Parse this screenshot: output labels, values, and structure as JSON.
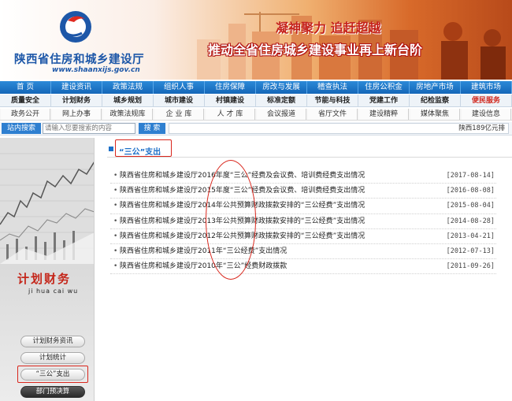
{
  "header": {
    "org_name": "陕西省住房和城乡建设厅",
    "url": "www.shaanxijs.gov.cn",
    "slogan1": "凝神聚力  追赶超越",
    "slogan2": "推动全省住房城乡建设事业再上新台阶"
  },
  "nav_primary": [
    "首    页",
    "建设资讯",
    "政策法规",
    "组织人事",
    "住房保障",
    "房改与发展",
    "稽查执法",
    "住房公积金",
    "房地产市场",
    "建筑市场"
  ],
  "nav_secondary": [
    "质量安全",
    "计划财务",
    "城乡规划",
    "城市建设",
    "村镇建设",
    "标准定额",
    "节能与科技",
    "党建工作",
    "纪检监察",
    "便民服务"
  ],
  "nav_tertiary": [
    "政务公开",
    "网上办事",
    "政策法规库",
    "企 业 库",
    "人 才 库",
    "会议报道",
    "省厅文件",
    "建设精粹",
    "媒体聚焦",
    "建设信息"
  ],
  "search": {
    "label": "站内搜索",
    "placeholder": "请输入您要搜索的内容",
    "button": "搜 索",
    "ticker": "陕西189亿元排"
  },
  "sidebar": {
    "title": "计划财务",
    "pinyin": "ji hua cai wu",
    "buttons": [
      "计划财务资讯",
      "计划统计",
      "“三公”支出",
      "部门预决算"
    ]
  },
  "section": {
    "title": "“三公”支出"
  },
  "articles": [
    {
      "title": "陕西省住房和城乡建设厅2016年度“三公”经费及会议费、培训费经费支出情况",
      "date": "[2017-08-14]"
    },
    {
      "title": "陕西省住房和城乡建设厅2015年度“三公”经费及会议费、培训费经费支出情况",
      "date": "[2016-08-08]"
    },
    {
      "title": "陕西省住房和城乡建设厅2014年公共预算财政拨款安排的“三公经费”支出情况",
      "date": "[2015-08-04]"
    },
    {
      "title": "陕西省住房和城乡建设厅2013年公共预算财政拨款安排的“三公经费”支出情况",
      "date": "[2014-08-28]"
    },
    {
      "title": "陕西省住房和城乡建设厅2012年公共预算财政拨款安排的“三公经费”支出情况",
      "date": "[2013-04-21]"
    },
    {
      "title": "陕西省住房和城乡建设厅2011年“三公经费”支出情况",
      "date": "[2012-07-13]"
    },
    {
      "title": "陕西省住房和城乡建设厅2010年“三公”经费财政拨款",
      "date": "[2011-09-26]"
    }
  ],
  "colors": {
    "brand_blue": "#1c6fc8",
    "highlight_red": "#d9261c"
  }
}
